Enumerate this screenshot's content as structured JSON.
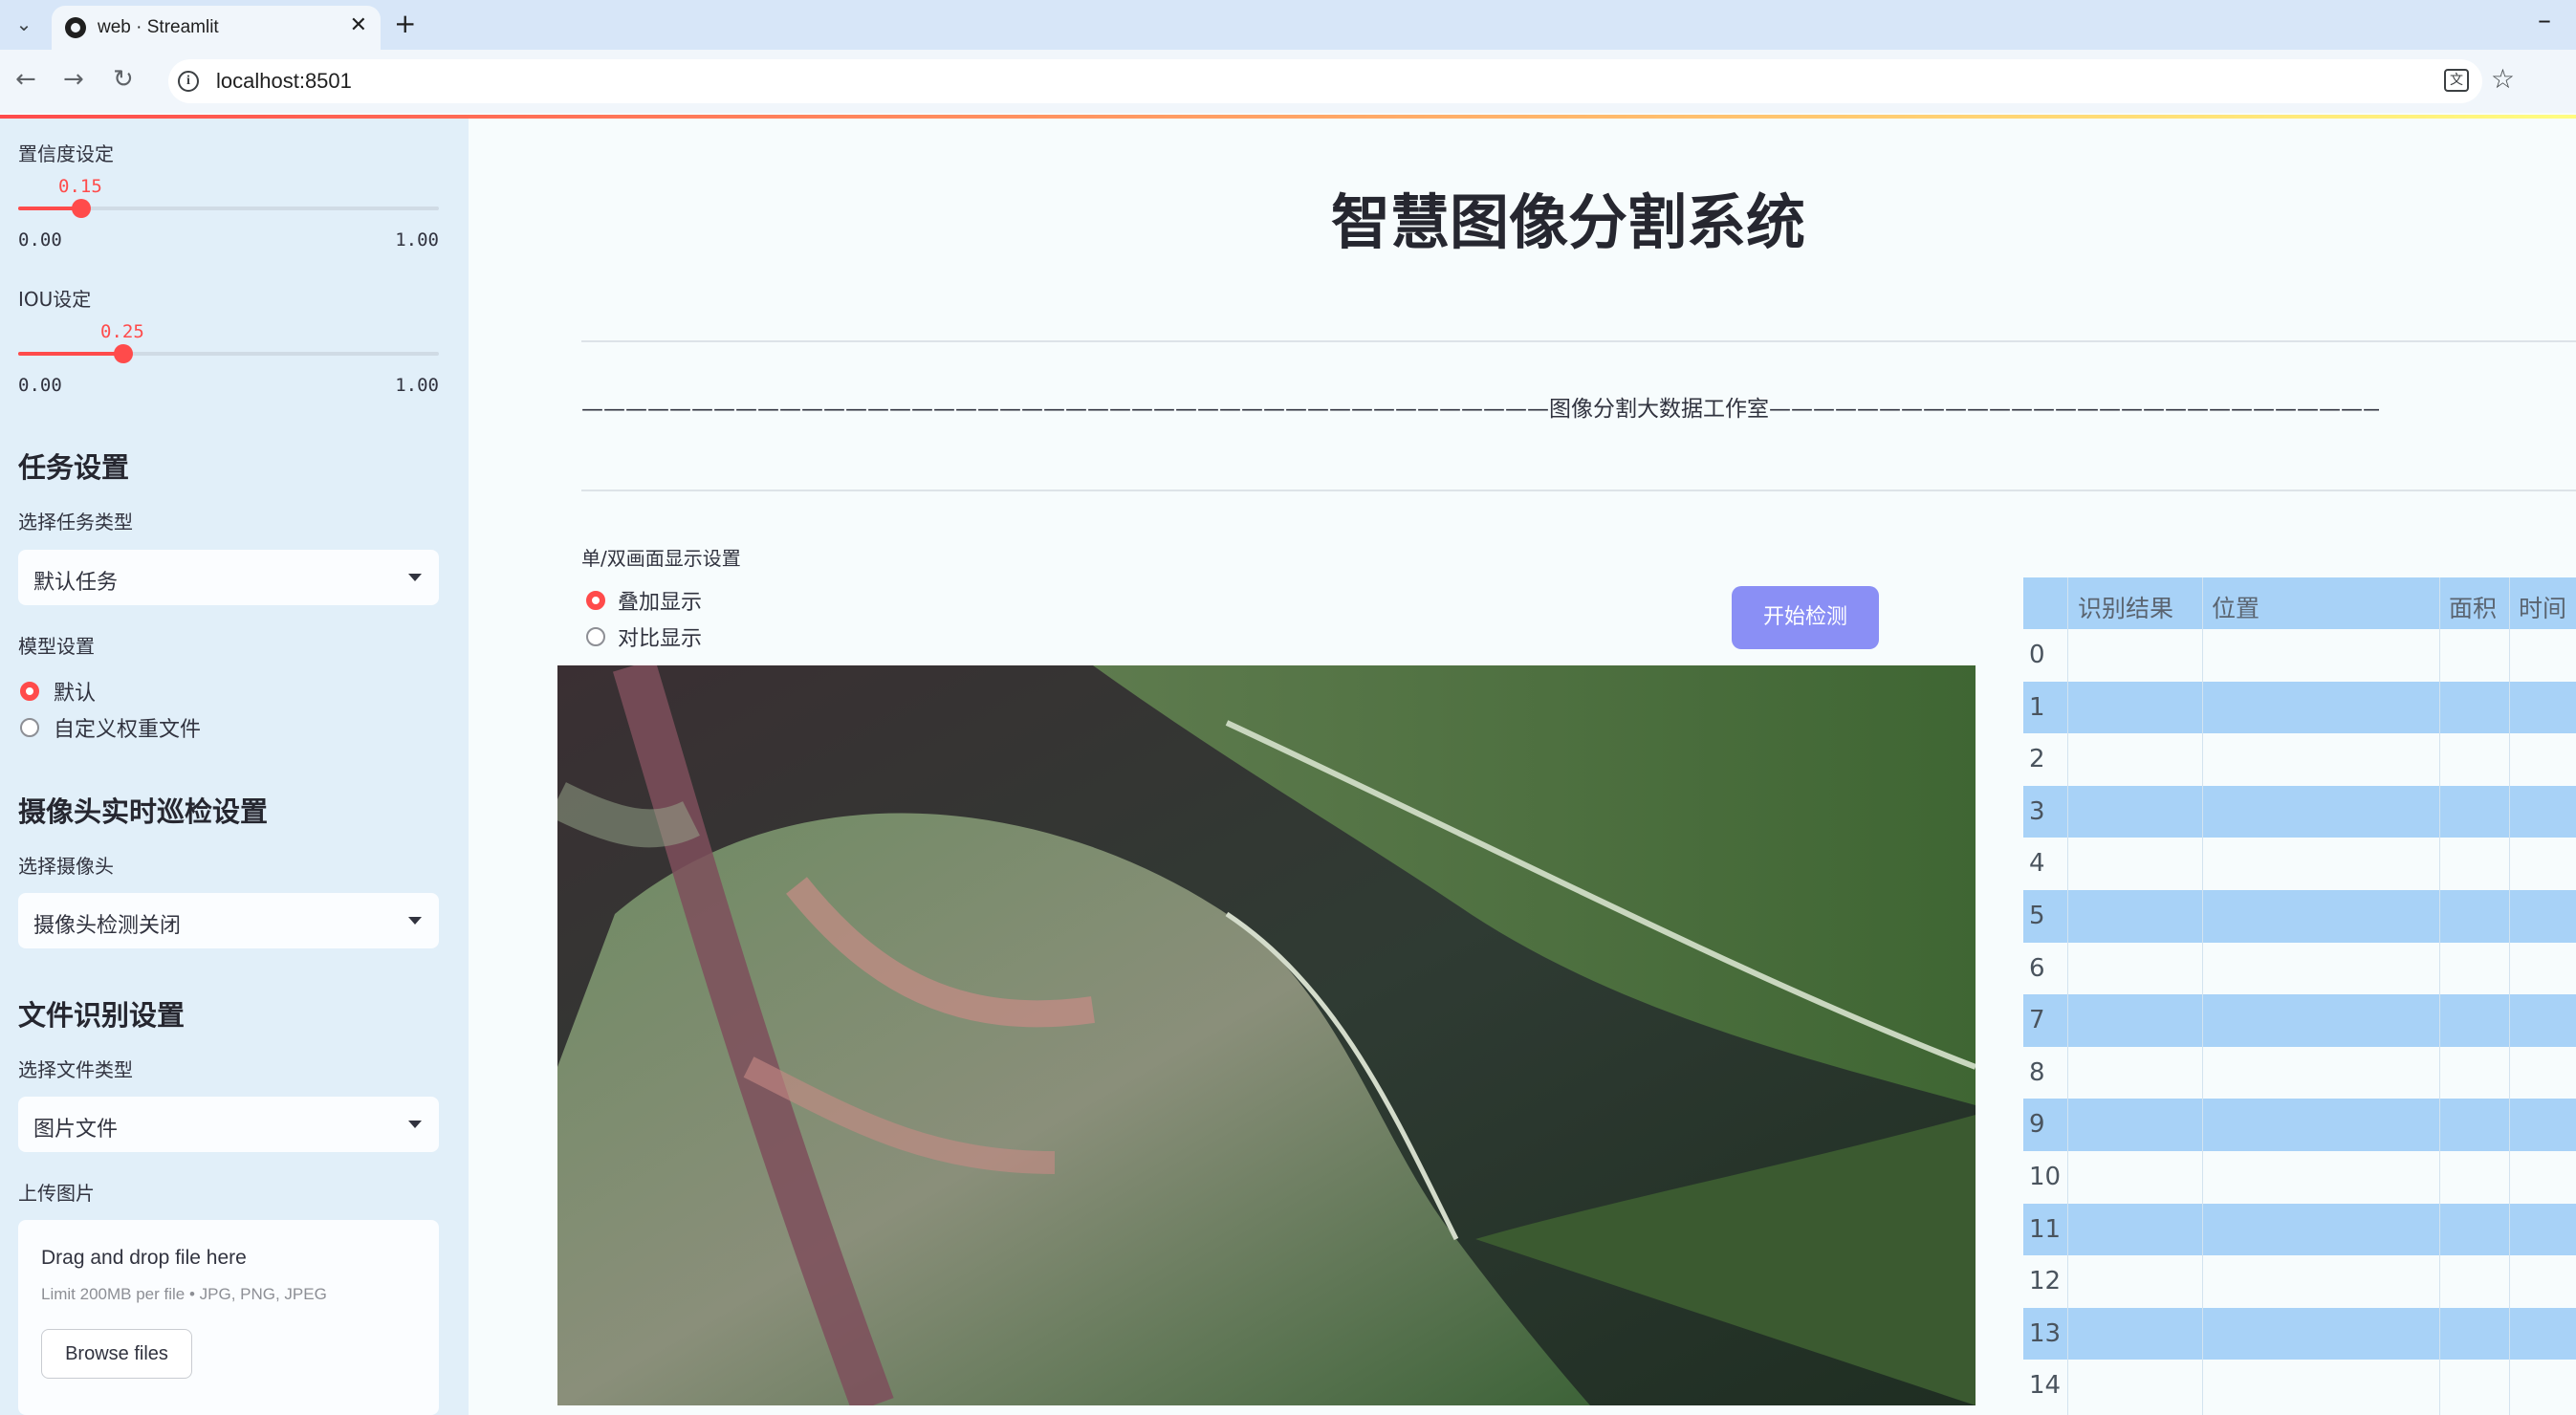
{
  "browser": {
    "tab_title": "web · Streamlit",
    "url": "localhost:8501"
  },
  "sidebar": {
    "confidence": {
      "label": "置信度设定",
      "value_text": "0.15",
      "value": 0.15,
      "min": "0.00",
      "max": "1.00"
    },
    "iou": {
      "label": "IOU设定",
      "value_text": "0.25",
      "value": 0.25,
      "min": "0.00",
      "max": "1.00"
    },
    "task_section": {
      "heading": "任务设置",
      "label": "选择任务类型",
      "selected": "默认任务"
    },
    "model_section": {
      "label": "模型设置",
      "options": [
        "默认",
        "自定义权重文件"
      ],
      "selected_index": 0
    },
    "camera_section": {
      "heading": "摄像头实时巡检设置",
      "label": "选择摄像头",
      "selected": "摄像头检测关闭"
    },
    "file_section": {
      "heading": "文件识别设置",
      "label": "选择文件类型",
      "selected": "图片文件"
    },
    "upload": {
      "label": "上传图片",
      "title": "Drag and drop file here",
      "limit": "Limit 200MB per file • JPG, PNG, JPEG",
      "button": "Browse files"
    }
  },
  "main": {
    "title": "智慧图像分割系统",
    "banner": "————————————————————————————————————————————图像分割大数据工作室————————————————————————————————————————————",
    "display_mode": {
      "label": "单/双画面显示设置",
      "options": [
        "叠加显示",
        "对比显示"
      ],
      "selected_index": 0
    },
    "start_button": "开始检测"
  },
  "results_table": {
    "columns": [
      "识别结果",
      "位置",
      "面积",
      "时间"
    ],
    "row_indices": [
      "0",
      "1",
      "2",
      "3",
      "4",
      "5",
      "6",
      "7",
      "8",
      "9",
      "10",
      "11",
      "12",
      "13",
      "14"
    ]
  },
  "colors": {
    "accent": "#ff4b4b",
    "sidebar_bg": "#e1eff9",
    "button_bg": "#8a8ff5",
    "table_stripe": "#a8d2f7"
  }
}
